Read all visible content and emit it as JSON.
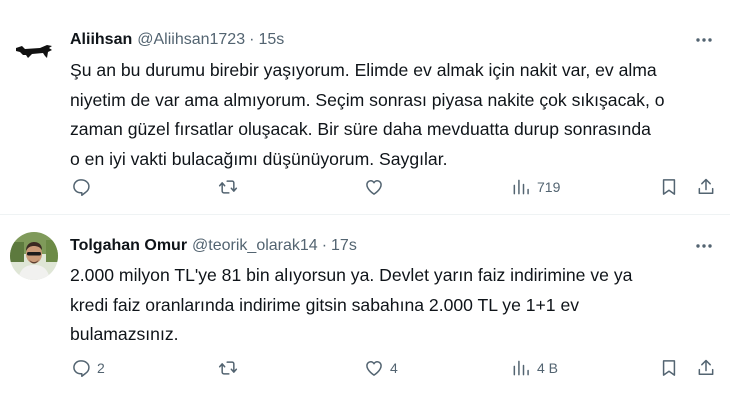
{
  "tweets": [
    {
      "name": "Aliihsan",
      "handle": "@Aliihsan1723",
      "separator": "·",
      "time": "15s",
      "lines": [
        "Şu an bu durumu birebir yaşıyorum. Elimde ev almak için nakit var, ev alma",
        "niyetim de var ama almıyorum. Seçim sonrası piyasa nakite çok sıkışacak, o",
        "zaman güzel fırsatlar oluşacak. Bir süre daha mevduatta durup sonrasında",
        "o en iyi vakti bulacağımı düşünüyorum. Saygılar."
      ],
      "reply_count": "",
      "retweet_count": "",
      "like_count": "",
      "views": "719"
    },
    {
      "name": "Tolgahan Omur",
      "handle": "@teorik_olarak14",
      "separator": "·",
      "time": "17s",
      "lines": [
        "2.000 milyon TL'ye 81 bin alıyorsun ya. Devlet yarın faiz indirimine ve ya",
        "kredi faiz oranlarında indirime gitsin sabahına 2.000 TL ye 1+1 ev",
        "bulamazsınız."
      ],
      "reply_count": "2",
      "retweet_count": "",
      "like_count": "4",
      "views": "4 B"
    }
  ],
  "icons": {
    "avatar1": "bull-logo-icon",
    "avatar2": "user-photo-avatar",
    "more": "more-dots-icon",
    "reply": "reply-icon",
    "retweet": "retweet-icon",
    "like": "heart-icon",
    "views": "analytics-icon",
    "bookmark": "bookmark-icon",
    "share": "share-icon"
  },
  "colors": {
    "text": "#0f1419",
    "secondary": "#536471",
    "divider": "#eff3f4",
    "background": "#ffffff"
  }
}
